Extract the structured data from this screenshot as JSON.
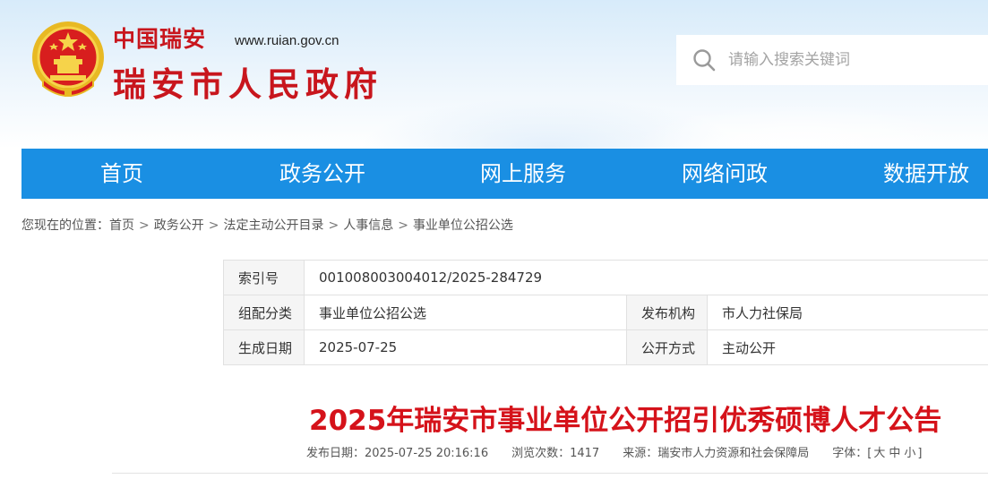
{
  "header": {
    "logo_cn": "中国瑞安",
    "logo_url": "www.ruian.gov.cn",
    "logo_name": "瑞安市人民政府",
    "search_placeholder": "请输入搜索关键词"
  },
  "nav": {
    "items": [
      "首页",
      "政务公开",
      "网上服务",
      "网络问政",
      "数据开放"
    ]
  },
  "breadcrumb": {
    "prefix": "您现在的位置：",
    "items": [
      "首页",
      "政务公开",
      "法定主动公开目录",
      "人事信息",
      "事业单位公招公选"
    ],
    "separator": ">"
  },
  "meta": {
    "index_label": "索引号",
    "index_value": "001008003004012/2025-284729",
    "category_label": "组配分类",
    "category_value": "事业单位公招公选",
    "publisher_label": "发布机构",
    "publisher_value": "市人力社保局",
    "date_label": "生成日期",
    "date_value": "2025-07-25",
    "open_label": "公开方式",
    "open_value": "主动公开"
  },
  "article": {
    "title": "2025年瑞安市事业单位公开招引优秀硕博人才公告",
    "publish_label": "发布日期：",
    "publish_value": "2025-07-25 20:16:16",
    "views_label": "浏览次数：",
    "views_value": "1417",
    "source_label": "来源：",
    "source_value": "瑞安市人力资源和社会保障局",
    "font_label": "字体：",
    "font_open": "[",
    "font_large": "大",
    "font_medium": "中",
    "font_small": "小",
    "font_close": "]"
  },
  "colors": {
    "nav_bg": "#1a8fe3",
    "title_red": "#d5121a",
    "logo_red": "#c8161d"
  }
}
